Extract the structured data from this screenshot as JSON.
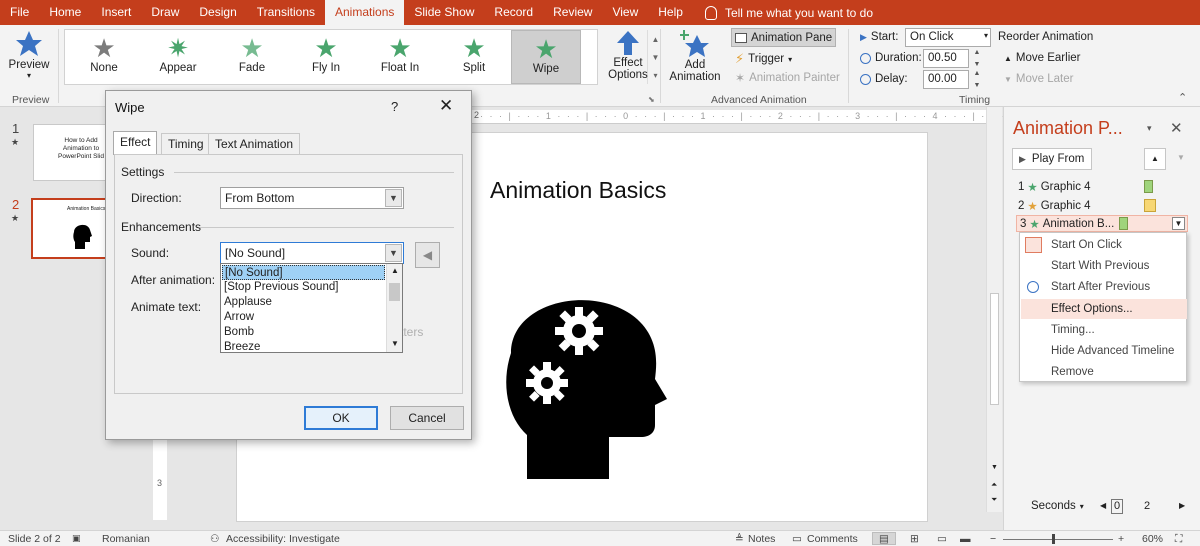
{
  "ribbon_tabs": [
    "File",
    "Home",
    "Insert",
    "Draw",
    "Design",
    "Transitions",
    "Animations",
    "Slide Show",
    "Record",
    "Review",
    "View",
    "Help"
  ],
  "active_tab": "Animations",
  "tell_me": "Tell me what you want to do",
  "preview": {
    "label": "Preview",
    "group": "Preview"
  },
  "gallery": {
    "items": [
      "None",
      "Appear",
      "Fade",
      "Fly In",
      "Float In",
      "Split",
      "Wipe"
    ],
    "selected": "Wipe"
  },
  "effect_options": {
    "line1": "Effect",
    "line2": "Options"
  },
  "advanced": {
    "add_line1": "Add",
    "add_line2": "Animation",
    "animation_pane": "Animation Pane",
    "trigger": "Trigger",
    "painter": "Animation Painter",
    "group": "Advanced Animation"
  },
  "timing": {
    "start_label": "Start:",
    "start_value": "On Click",
    "duration_label": "Duration:",
    "duration_value": "00.50",
    "delay_label": "Delay:",
    "delay_value": "00.00",
    "reorder": "Reorder Animation",
    "move_earlier": "Move Earlier",
    "move_later": "Move Later",
    "group": "Timing"
  },
  "thumbnails": [
    {
      "number": "1",
      "text": "How to Add Animation to PowerPoint Slid"
    },
    {
      "number": "2",
      "text": "Animation Basics"
    }
  ],
  "slide": {
    "title": "Animation Basics"
  },
  "animation_pane": {
    "title": "Animation P...",
    "play_from": "Play From",
    "items": [
      {
        "num": "1",
        "name": "Graphic 4",
        "color": "#9fd47c"
      },
      {
        "num": "2",
        "name": "Graphic 4",
        "color": "#f7d774"
      },
      {
        "num": "3",
        "name": "Animation B...",
        "color": "#9fd47c"
      }
    ],
    "menu": [
      "Start On Click",
      "Start With Previous",
      "Start After Previous",
      "Effect Options...",
      "Timing...",
      "Hide Advanced Timeline",
      "Remove"
    ],
    "seconds": "Seconds",
    "ruler_start": "0",
    "ruler_end": "2"
  },
  "dialog": {
    "title": "Wipe",
    "help": "?",
    "tabs": [
      "Effect",
      "Timing",
      "Text Animation"
    ],
    "settings_header": "Settings",
    "direction_label": "Direction:",
    "direction_value": "From Bottom",
    "enhancements_header": "Enhancements",
    "sound_label": "Sound:",
    "sound_value": "[No Sound]",
    "after_label": "After animation:",
    "animate_text_label": "Animate text:",
    "letters_hint": "tters",
    "sound_options": [
      "[No Sound]",
      "[Stop Previous Sound]",
      "Applause",
      "Arrow",
      "Bomb",
      "Breeze"
    ],
    "ok": "OK",
    "cancel": "Cancel"
  },
  "status": {
    "slide": "Slide 2 of 2",
    "language": "Romanian",
    "accessibility": "Accessibility: Investigate",
    "notes": "Notes",
    "comments": "Comments",
    "zoom": "60%"
  },
  "colors": {
    "accent": "#c43e1c",
    "star_green": "#4aa56d",
    "menu_highlight": "#fbe3dc",
    "list_selection": "#9fd1f5"
  }
}
